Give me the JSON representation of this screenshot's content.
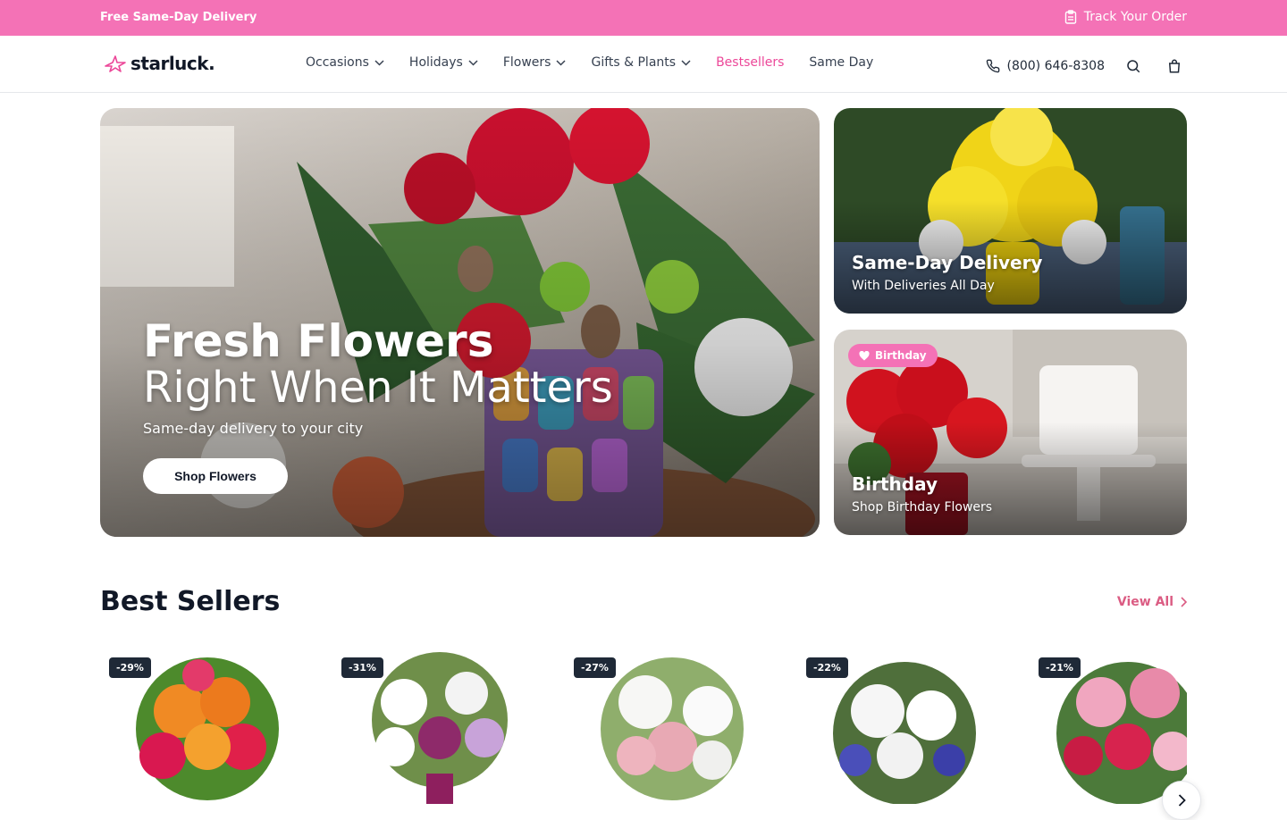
{
  "promo": {
    "left_text": "Free Same-Day Delivery",
    "track_label": "Track Your Order"
  },
  "header": {
    "logo": "starluck.",
    "nav": [
      {
        "label": "Occasions",
        "dropdown": true
      },
      {
        "label": "Holidays",
        "dropdown": true
      },
      {
        "label": "Flowers",
        "dropdown": true
      },
      {
        "label": "Gifts & Plants",
        "dropdown": true
      },
      {
        "label": "Bestsellers",
        "dropdown": false,
        "active": true
      },
      {
        "label": "Same Day",
        "dropdown": false
      }
    ],
    "phone": "(800) 646-8308"
  },
  "hero": {
    "title_line1": "Fresh Flowers",
    "title_line2": "Right When It Matters",
    "subtitle": "Same-day delivery to your city",
    "button": "Shop Flowers"
  },
  "cards": [
    {
      "title": "Same-Day Delivery",
      "subtitle": "With Deliveries All Day"
    },
    {
      "badge": "Birthday",
      "title": "Birthday",
      "subtitle": "Shop Birthday Flowers"
    }
  ],
  "best_sellers": {
    "title": "Best Sellers",
    "view_all": "View All",
    "products": [
      {
        "discount": "-29%"
      },
      {
        "discount": "-31%"
      },
      {
        "discount": "-27%"
      },
      {
        "discount": "-22%"
      },
      {
        "discount": "-21%"
      }
    ]
  },
  "colors": {
    "brand_pink": "#f472b6",
    "accent_text": "#db5c83",
    "dark": "#111827"
  }
}
